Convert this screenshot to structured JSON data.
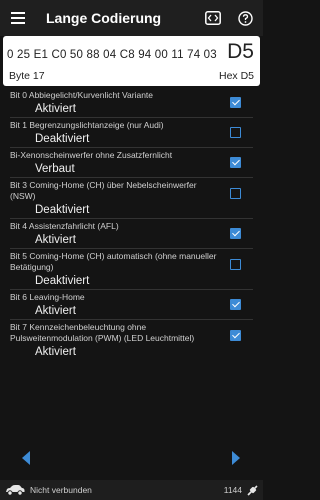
{
  "header": {
    "title": "Lange Codierung",
    "menu_icon": "hamburger-menu-icon",
    "code_icon": "code-icon",
    "help_icon": "help-icon"
  },
  "hex": {
    "line": "0 25 E1 C0 50 88 04 C8 94 00 11 74 03",
    "big": "D5",
    "byte_label": "Byte 17",
    "hex_label": "Hex D5"
  },
  "bits": [
    {
      "label": "Bit 0 Abbiegelicht/Kurvenlicht Variante",
      "value": "Aktiviert",
      "checked": true
    },
    {
      "label": "Bit 1 Begrenzungslichtanzeige (nur Audi)",
      "value": "Deaktiviert",
      "checked": false
    },
    {
      "label": "Bi-Xenonscheinwerfer ohne Zusatzfernlicht",
      "value": "Verbaut",
      "checked": true
    },
    {
      "label": "Bit 3 Coming-Home (CH) über Nebelscheinwerfer (NSW)",
      "value": "Deaktiviert",
      "checked": false
    },
    {
      "label": "Bit 4 Assistenzfahrlicht (AFL)",
      "value": "Aktiviert",
      "checked": true
    },
    {
      "label": "Bit 5 Coming-Home (CH) automatisch (ohne manueller Betätigung)",
      "value": "Deaktiviert",
      "checked": false
    },
    {
      "label": "Bit 6 Leaving-Home",
      "value": "Aktiviert",
      "checked": true
    },
    {
      "label": "Bit 7 Kennzeichenbeleuchtung ohne Pulsweitenmodulation (PWM) (LED Leuchtmittel)",
      "value": "Aktiviert",
      "checked": true
    }
  ],
  "nav": {
    "prev_icon": "arrow-left-icon",
    "next_icon": "arrow-right-icon"
  },
  "status": {
    "text": "Nicht verbunden",
    "count": "1144",
    "car_icon": "car-icon",
    "plug_icon": "plug-icon"
  },
  "colors": {
    "accent": "#3d8bd6",
    "background": "#141414",
    "appbar": "#1f1f1f"
  }
}
